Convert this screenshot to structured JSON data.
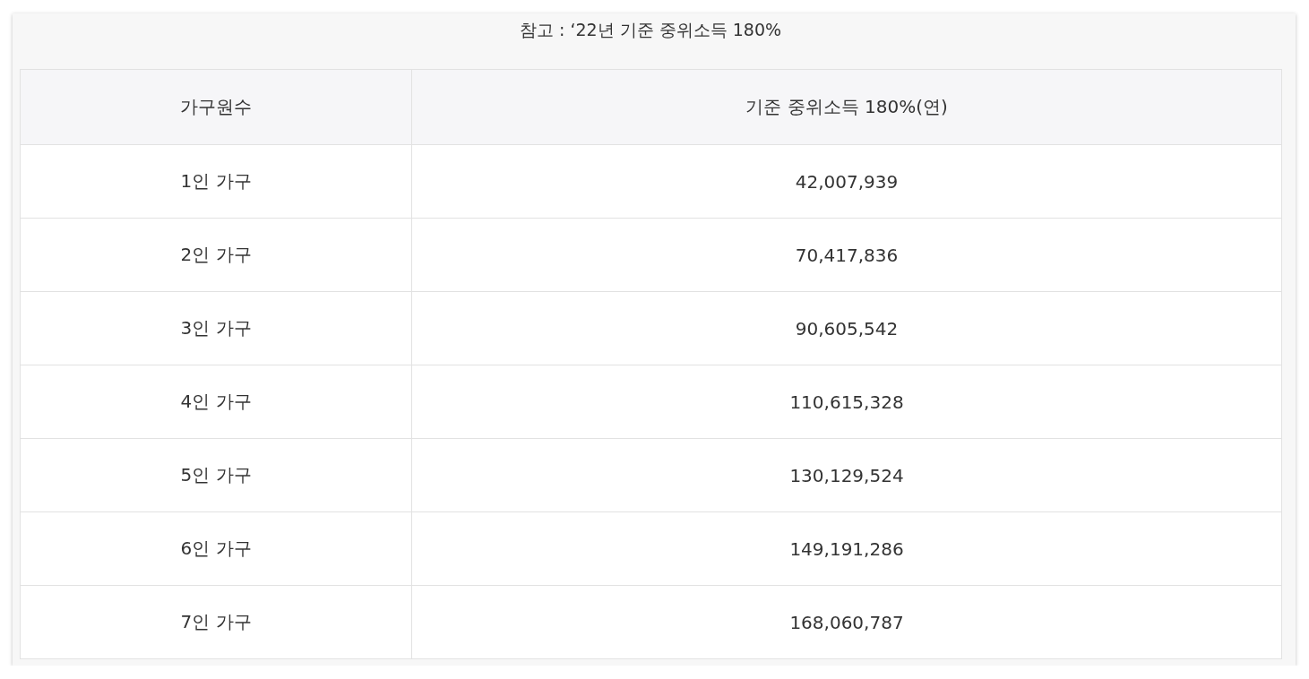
{
  "caption": "참고 : ‘22년 기준 중위소득 180%",
  "table": {
    "columns": [
      "가구원수",
      "기준 중위소득 180%(연)"
    ],
    "rows": [
      [
        "1인 가구",
        "42,007,939"
      ],
      [
        "2인 가구",
        "70,417,836"
      ],
      [
        "3인 가구",
        "90,605,542"
      ],
      [
        "4인 가구",
        "110,615,328"
      ],
      [
        "5인 가구",
        "130,129,524"
      ],
      [
        "6인 가구",
        "149,191,286"
      ],
      [
        "7인 가구",
        "168,060,787"
      ]
    ]
  }
}
